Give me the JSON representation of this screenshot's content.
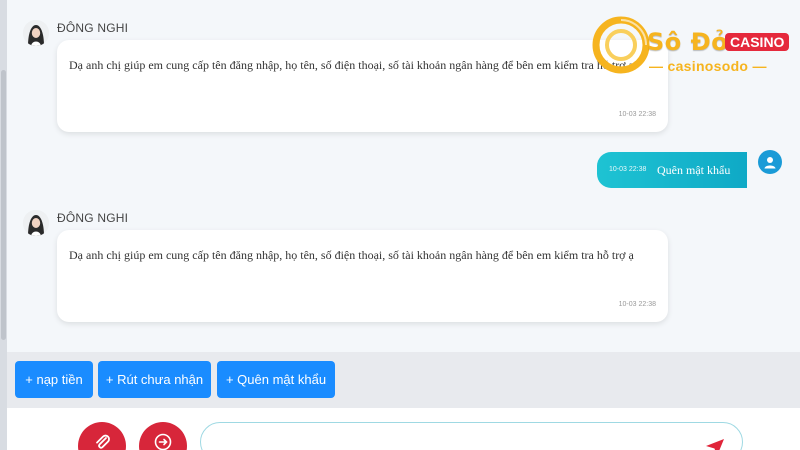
{
  "messages": [
    {
      "sender": "ĐÔNG NGHI",
      "text": "Dạ anh chị giúp em cung cấp tên đăng nhập, họ tên, số điện thoại, số tài khoản ngân hàng để bên em kiểm tra hỗ trợ ạ",
      "time": "10-03 22:38"
    },
    {
      "sender": "ĐÔNG NGHI",
      "text": "Dạ anh chị giúp em cung cấp tên đăng nhập, họ tên, số điện thoại, số tài khoản ngân hàng để bên em kiểm tra hỗ trợ ạ",
      "time": "10-03 22:38"
    }
  ],
  "user_message": {
    "time": "10-03 22:38",
    "text": "Quên mật khẩu"
  },
  "logo": {
    "brand": "Sô Đỏ",
    "badge": "CASINO",
    "subtitle": "— casinosodo —"
  },
  "quick_replies": [
    "+ nạp tiền",
    "+ Rút chưa nhận",
    "+ Quên mật khẩu"
  ],
  "input": {
    "value": "",
    "placeholder": ""
  },
  "icons": {
    "avatar": "agent-avatar",
    "user": "user-icon",
    "attach": "paperclip-icon",
    "exit": "exit-icon",
    "send": "send-icon"
  },
  "colors": {
    "accent": "#1a8cff",
    "user_bubble": "#17b6cc",
    "action_red": "#d7263a",
    "logo_gold": "#f6b41f"
  }
}
